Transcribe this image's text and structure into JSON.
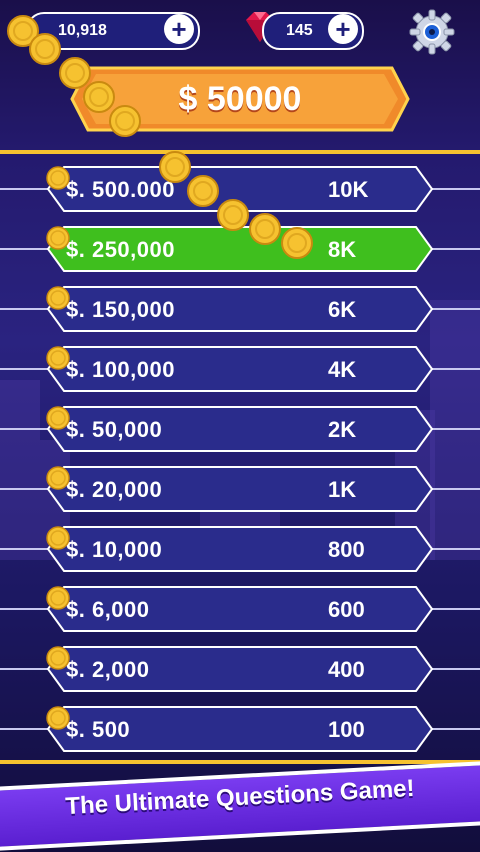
{
  "top_bar": {
    "coins": "10,918",
    "gems": "145",
    "add_symbol": "+",
    "icons": {
      "coin": "coin-icon",
      "gem": "gem-icon",
      "settings": "gear-icon"
    }
  },
  "header": {
    "prize": "$ 50000"
  },
  "ladder": [
    {
      "amount": "$. 500.000",
      "reward": "10K",
      "active": false
    },
    {
      "amount": "$. 250,000",
      "reward": "8K",
      "active": true
    },
    {
      "amount": "$. 150,000",
      "reward": "6K",
      "active": false
    },
    {
      "amount": "$. 100,000",
      "reward": "4K",
      "active": false
    },
    {
      "amount": "$. 50,000",
      "reward": "2K",
      "active": false
    },
    {
      "amount": "$. 20,000",
      "reward": "1K",
      "active": false
    },
    {
      "amount": "$. 10,000",
      "reward": "800",
      "active": false
    },
    {
      "amount": "$. 6,000",
      "reward": "600",
      "active": false
    },
    {
      "amount": "$. 2,000",
      "reward": "400",
      "active": false
    },
    {
      "amount": "$. 500",
      "reward": "100",
      "active": false
    }
  ],
  "banner": {
    "text": "The Ultimate Questions Game!"
  },
  "colors": {
    "gold": "#f6c230",
    "active_rung": "#3fbf1e",
    "inactive_rung": "#2a2c8c",
    "badge": "#f08a2a"
  }
}
